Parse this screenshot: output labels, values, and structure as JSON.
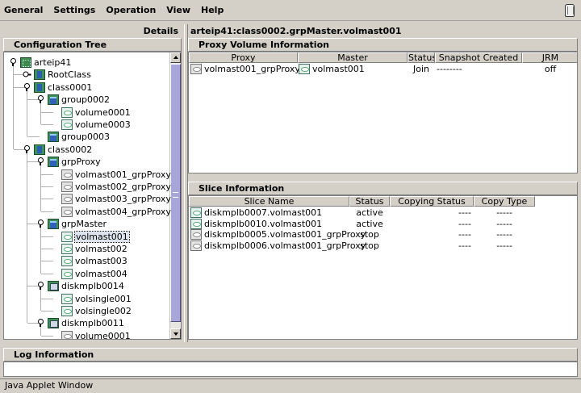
{
  "menu": {
    "items": [
      "General",
      "Settings",
      "Operation",
      "View",
      "Help"
    ],
    "trash_icon": "trash-icon"
  },
  "details": {
    "label": "Details"
  },
  "path": {
    "title": "arteip41:class0002.grpMaster.volmast001"
  },
  "tree": {
    "header": "Configuration Tree",
    "nodes": [
      {
        "label": "arteip41",
        "icon": "host-icon",
        "level": 0,
        "expanded": true
      },
      {
        "label": "RootClass",
        "icon": "class-icon",
        "level": 1,
        "expanded": false
      },
      {
        "label": "class0001",
        "icon": "class-icon",
        "level": 1,
        "expanded": true
      },
      {
        "label": "group0002",
        "icon": "group-icon",
        "level": 2,
        "expanded": true
      },
      {
        "label": "volume0001",
        "icon": "volume-icon",
        "level": 3
      },
      {
        "label": "volume0003",
        "icon": "volume-icon",
        "level": 3
      },
      {
        "label": "group0003",
        "icon": "group-icon",
        "level": 2
      },
      {
        "label": "class0002",
        "icon": "class-icon",
        "level": 1,
        "expanded": true
      },
      {
        "label": "grpProxy",
        "icon": "group-icon",
        "level": 2,
        "expanded": true
      },
      {
        "label": "volmast001_grpProxy",
        "icon": "volume-gray-icon",
        "level": 3
      },
      {
        "label": "volmast002_grpProxy",
        "icon": "volume-gray-icon",
        "level": 3
      },
      {
        "label": "volmast003_grpProxy",
        "icon": "volume-gray-icon",
        "level": 3
      },
      {
        "label": "volmast004_grpProxy",
        "icon": "volume-gray-icon",
        "level": 3
      },
      {
        "label": "grpMaster",
        "icon": "group-icon",
        "level": 2,
        "expanded": true
      },
      {
        "label": "volmast001",
        "icon": "volume-icon",
        "level": 3,
        "selected": true
      },
      {
        "label": "volmast002",
        "icon": "volume-icon",
        "level": 3
      },
      {
        "label": "volmast003",
        "icon": "volume-icon",
        "level": 3
      },
      {
        "label": "volmast004",
        "icon": "volume-icon",
        "level": 3
      },
      {
        "label": "diskmplb0014",
        "icon": "disk-icon",
        "level": 2,
        "expanded": true
      },
      {
        "label": "volsingle001",
        "icon": "volume-icon",
        "level": 3
      },
      {
        "label": "volsingle002",
        "icon": "volume-icon",
        "level": 3
      },
      {
        "label": "diskmplb0011",
        "icon": "disk-icon",
        "level": 2,
        "expanded": true
      },
      {
        "label": "volume0001",
        "icon": "volume-gray-icon",
        "level": 3
      }
    ]
  },
  "proxy_volume": {
    "header": "Proxy Volume Information",
    "columns": [
      "Proxy",
      "Master",
      "Status",
      "Snapshot Created",
      "JRM"
    ],
    "rows": [
      {
        "proxy": "volmast001_grpProxy",
        "master": "volmast001",
        "status": "Join",
        "snapshot": "--------",
        "jrm": "off"
      }
    ]
  },
  "slice": {
    "header": "Slice Information",
    "columns": [
      "Slice Name",
      "Status",
      "Copying Status",
      "Copy Type"
    ],
    "rows": [
      {
        "name": "diskmplb0007.volmast001",
        "icon": "volume-icon",
        "status": "active",
        "copying": "----",
        "type": "-----"
      },
      {
        "name": "diskmplb0010.volmast001",
        "icon": "volume-icon",
        "status": "active",
        "copying": "----",
        "type": "-----"
      },
      {
        "name": "diskmplb0005.volmast001_grpProxy",
        "icon": "volume-gray-icon",
        "status": "stop",
        "copying": "----",
        "type": "-----"
      },
      {
        "name": "diskmplb0006.volmast001_grpProxy",
        "icon": "volume-gray-icon",
        "status": "stop",
        "copying": "----",
        "type": "-----"
      }
    ]
  },
  "log": {
    "header": "Log Information"
  },
  "status_bar": {
    "text": "Java Applet Window"
  }
}
